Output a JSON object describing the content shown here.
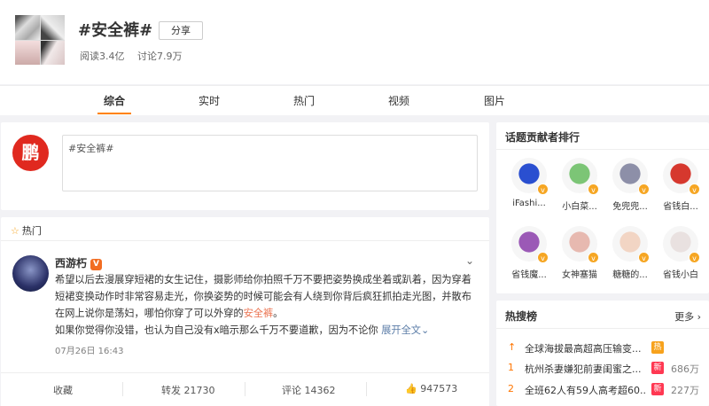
{
  "header": {
    "topic_title": "#安全裤#",
    "share_label": "分享",
    "read_count": "阅读3.4亿",
    "discuss_count": "讨论7.9万"
  },
  "tabs": [
    {
      "label": "综合",
      "active": true
    },
    {
      "label": "实时",
      "active": false
    },
    {
      "label": "热门",
      "active": false
    },
    {
      "label": "视频",
      "active": false
    },
    {
      "label": "图片",
      "active": false
    }
  ],
  "compose": {
    "avatar_glyph": "鹏",
    "text": "#安全裤#"
  },
  "feed": {
    "section_label": "热门",
    "post": {
      "author": "西游朽",
      "verified_badge": "V",
      "text_part1": "希望以后去漫展穿短裙的女生记住，摄影师给你拍照千万不要把姿势换成坐着或趴着，因为穿着短裙变换动作时非常容易走光，你换姿势的时候可能会有人绕到你背后疯狂抓拍走光图，并散布在网上说你是荡妇，哪怕你穿了可以外穿的",
      "text_link": "安全裤",
      "text_part2": "。",
      "text_line2": "如果你觉得你没错，也认为自己没有x暗示那么千万不要道歉，因为不论你",
      "expand_label": "展开全文",
      "time": "07月26日 16:43"
    },
    "actions": {
      "favorite": "收藏",
      "repost": "转发 21730",
      "comment": "评论 14362",
      "like": "947573"
    }
  },
  "contributors": {
    "title": "话题贡献者排行",
    "items": [
      {
        "name": "iFashi...",
        "color": "#2a4fd0"
      },
      {
        "name": "小白菜...",
        "color": "#7cc576"
      },
      {
        "name": "免兜兜...",
        "color": "#8d8fa8"
      },
      {
        "name": "省钱白...",
        "color": "#d6382e"
      },
      {
        "name": "省钱魔...",
        "color": "#9b59b6"
      },
      {
        "name": "女神塞猫",
        "color": "#e7b9b0"
      },
      {
        "name": "糖糖的...",
        "color": "#f2d5c4"
      },
      {
        "name": "省钱小白",
        "color": "#e9e1e0"
      }
    ]
  },
  "hot_search": {
    "title": "热搜榜",
    "more_label": "更多 ›",
    "items": [
      {
        "index": "↑",
        "text": "全球海拔最高超高压输变...",
        "tag": "热",
        "tag_color": "#f7a21c",
        "count": ""
      },
      {
        "index": "1",
        "text": "杭州杀妻嫌犯前妻闺蜜之...",
        "tag": "新",
        "tag_color": "#ff3852",
        "count": "686万"
      },
      {
        "index": "2",
        "text": "全班62人有59人高考超60...",
        "tag": "新",
        "tag_color": "#ff3852",
        "count": "227万"
      }
    ]
  }
}
